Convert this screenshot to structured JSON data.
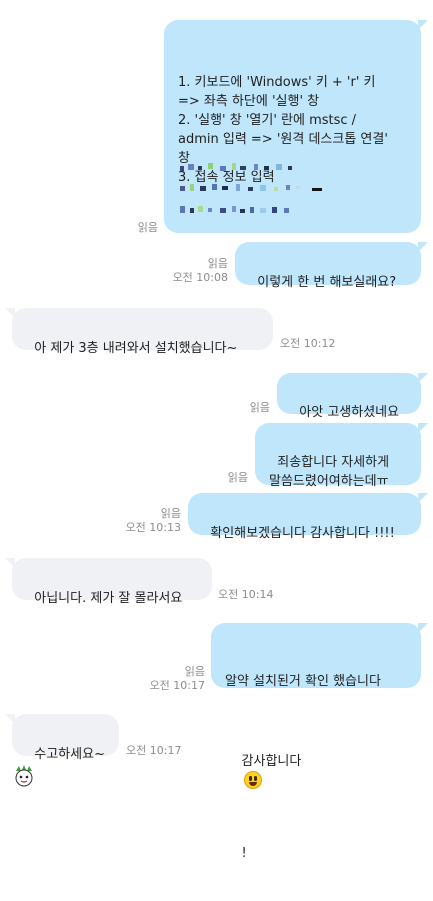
{
  "colors": {
    "mine_bubble": "#bfe6fb",
    "theirs_bubble": "#eff1f5",
    "meta_text": "#8d8d8d"
  },
  "messages": [
    {
      "side": "mine",
      "text": "1. 키보드에 'Windows' 키 + 'r' 키\n=> 좌측 하단에 '실행' 창\n2. '실행' 창 '열기' 란에 mstsc /\nadmin 입력 => '원격 데스크톱 연결'\n창\n3. 접속 정보 입력",
      "read": "읽음",
      "time": "",
      "redacted": true
    },
    {
      "side": "mine",
      "text": "이렇게 한 번 해보실래요?",
      "read": "읽음",
      "time": "오전 10:08"
    },
    {
      "side": "theirs",
      "text": "아 제가 3층 내려와서 설치했습니다~",
      "read": "",
      "time": "오전 10:12"
    },
    {
      "side": "mine",
      "text": "아앗 고생하셨네요",
      "read": "읽음",
      "time": ""
    },
    {
      "side": "mine",
      "text": "죄송합니다 자세하게\n말씀드렸어여하는데ㅠ",
      "read": "읽음",
      "time": ""
    },
    {
      "side": "mine",
      "text": "확인해보겠습니다 감사합니다 !!!!",
      "read": "읽음",
      "time": "오전 10:13"
    },
    {
      "side": "theirs",
      "text": "아닙니다. 제가 잘 몰라서요",
      "read": "",
      "time": "오전 10:14"
    },
    {
      "side": "mine",
      "text_line1": "알약 설치된거 확인 했습니다",
      "text_line2_before": "감사합니다 ",
      "emoji": "grinning-emoji",
      "text_line2_after": "!",
      "read": "읽음",
      "time": "오전 10:17"
    },
    {
      "side": "theirs",
      "text": "수고하세요~",
      "read": "",
      "time": "오전 10:17"
    }
  ]
}
